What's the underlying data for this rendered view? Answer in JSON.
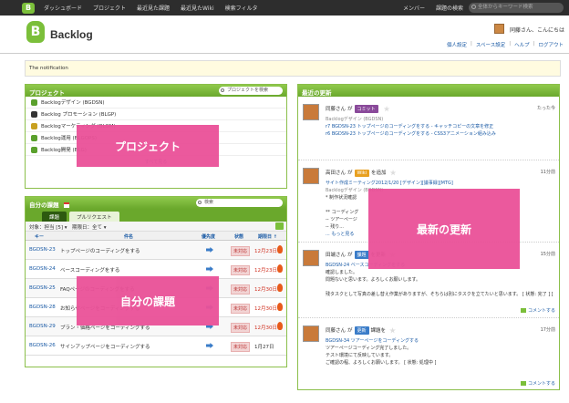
{
  "topbar": {
    "logo": "B",
    "nav": [
      "ダッシュボード",
      "プロジェクト",
      "最近見た課題",
      "最近見たWiki",
      "検索フィルタ"
    ],
    "right": [
      "メンバー",
      "課題の検索"
    ],
    "search_placeholder": "全体からキーワード検索"
  },
  "header": {
    "logo_letter": "B",
    "app_name": "Backlog",
    "greeting": "同藤さん、こんにちは",
    "links": [
      "個人設定",
      "スペース設定",
      "ヘルプ",
      "ログアウト"
    ]
  },
  "notice": "The notification",
  "projects": {
    "title": "プロジェクト",
    "search_placeholder": "プロジェクトを検索",
    "items": [
      {
        "name": "Backlogデザイン (BGDSN)",
        "color": "#5aa02c"
      },
      {
        "name": "Backlog プロモーション (BLGP)",
        "color": "#333333"
      },
      {
        "name": "Backlogマーケティング (BLGM)",
        "color": "#c8a020"
      },
      {
        "name": "Backlog運用 (BLGOPS)",
        "color": "#5aa02c"
      },
      {
        "name": "Backlog開発 (BLG)",
        "color": "#5aa02c"
      }
    ],
    "see_all": "すべて見る",
    "overlay": "プロジェクト"
  },
  "issues": {
    "title": "自分の課題",
    "search_placeholder": "検索",
    "tabs": [
      "課題",
      "プルリクエスト"
    ],
    "filter": "対象：担当 [5] ▾　期限日：全て ▾",
    "columns": {
      "key": "キー",
      "summary": "件名",
      "priority": "優先度",
      "status": "状態",
      "due": "期限日 ↑"
    },
    "rows": [
      {
        "key": "BGDSN-23",
        "summary": "トップページのコーディングをする",
        "status": "未対応",
        "due": "12月23日",
        "overdue": true
      },
      {
        "key": "BGDSN-24",
        "summary": "ベースコーディングをする",
        "status": "未対応",
        "due": "12月23日",
        "overdue": true
      },
      {
        "key": "BGDSN-25",
        "summary": "FAQページのコーディングをする",
        "status": "未対応",
        "due": "12月30日",
        "overdue": true
      },
      {
        "key": "BGDSN-28",
        "summary": "お知らせページをコーディングする",
        "status": "未対応",
        "due": "12月30日",
        "overdue": true
      },
      {
        "key": "BGDSN-29",
        "summary": "プラン・価格ページをコーディングする",
        "status": "未対応",
        "due": "12月30日",
        "overdue": true
      },
      {
        "key": "BGDSN-26",
        "summary": "サインアップページをコーディングする",
        "status": "未対応",
        "due": "1月27日",
        "overdue": false
      }
    ],
    "overlay": "自分の課題"
  },
  "feed": {
    "title": "最近の更新",
    "overlay": "最新の更新",
    "items": [
      {
        "user": "同藤さん",
        "verb": "が",
        "badge": "コミット",
        "badge_color": "#8a4a9a",
        "time": "たった今",
        "lines": [
          "Backlogデザイン (BGDSN)",
          "r7  BGDSN-23 トップページのコーディングをする - キャッチコピーの文章を修正",
          "r6  BGDSN-23 トップページのコーディングをする - CSS3アニメーション組み込み"
        ]
      },
      {
        "user": "高田さん",
        "verb": "が",
        "badge": "Wiki",
        "badge_color": "#e8a020",
        "extra": "を追加",
        "time": "11分前",
        "lines": [
          "サイト作成ミーティング2012/1/20 [デザイン][議事録][MTG]",
          "Backlogデザイン (BGDSN)",
          "* 制作状況確認",
          "",
          "** コーディング",
          "-- ツアーページ",
          "-- 残り...",
          "... もっと見る"
        ]
      },
      {
        "user": "田端さん",
        "verb": "が",
        "badge": "課題",
        "badge_color": "#3a7cc8",
        "extra": "を更新",
        "time": "15分前",
        "lines": [
          "BGDSN-24 ベースコーディングをする",
          "確認しました。",
          "問題ないと思います。よろしくお願いします。",
          "",
          "残タスクとして写真の差し替え作業がありますが、そちらは別にタスクを立てたいと思います。 [ 状態: 完了 ] [ 状態: 対応済み ]"
        ],
        "comment": "コメントする"
      },
      {
        "user": "同藤さん",
        "verb": "が",
        "badge": "更新",
        "badge_color": "#3a7cc8",
        "extra": "課題を",
        "time": "17分前",
        "lines": [
          "BGDSN-34 ツアーページをコーディングする",
          "ツアーページコーディング完了しました。",
          "テスト環境にて反映しています。",
          "ご確認の程、よろしくお願いします。 [ 状態: 処理中 ]"
        ],
        "comment": "コメントする"
      }
    ]
  }
}
